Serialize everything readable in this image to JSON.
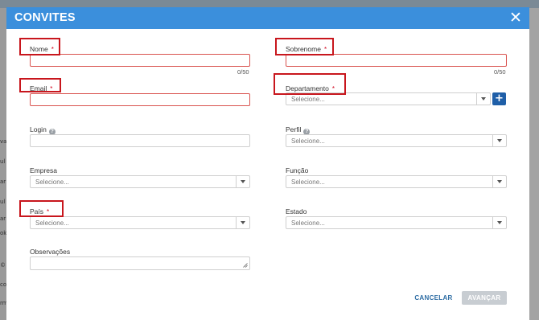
{
  "modal": {
    "title": "CONVITES",
    "close_icon": "close-icon"
  },
  "fields": {
    "nome": {
      "label": "Nome",
      "required_mark": "*",
      "counter": "0/50"
    },
    "sobrenome": {
      "label": "Sobrenome",
      "required_mark": "*",
      "counter": "0/50"
    },
    "email": {
      "label": "Email",
      "required_mark": "*"
    },
    "departamento": {
      "label": "Departamento",
      "required_mark": "*",
      "placeholder": "Selecione..."
    },
    "login": {
      "label": "Login",
      "help": "?"
    },
    "perfil": {
      "label": "Perfil",
      "help": "?",
      "placeholder": "Selecione..."
    },
    "empresa": {
      "label": "Empresa",
      "placeholder": "Selecione..."
    },
    "funcao": {
      "label": "Função",
      "placeholder": "Selecione..."
    },
    "pais": {
      "label": "País",
      "required_mark": "*",
      "placeholder": "Selecione..."
    },
    "estado": {
      "label": "Estado",
      "placeholder": "Selecione..."
    },
    "observacoes": {
      "label": "Observações"
    }
  },
  "actions": {
    "cancel": "CANCELAR",
    "next": "AVANÇAR",
    "add": "+"
  },
  "background": {
    "snippets": [
      "va",
      "ul",
      "ar",
      "ul",
      "ar",
      "ok",
      "©",
      "co",
      "rm"
    ]
  },
  "colors": {
    "header": "#3b8fdc",
    "highlight": "#c8161d",
    "primary": "#1f5fa8",
    "error_border": "#d9534f"
  }
}
